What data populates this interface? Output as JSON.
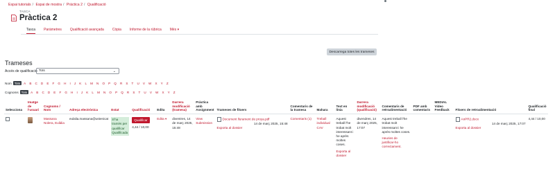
{
  "breadcrumbs": [
    "Espai tutorials",
    "Espai de mostra",
    "Pràctica 2",
    "Qualificació"
  ],
  "header": {
    "kicker": "TASCA",
    "title": "Pràctica 2"
  },
  "tabs": [
    {
      "label": "Tasca",
      "active": true
    },
    {
      "label": "Paràmetres",
      "active": false
    },
    {
      "label": "Qualificació avançada",
      "active": false
    },
    {
      "label": "Còpia",
      "active": false
    },
    {
      "label": "Informe de la rúbrica",
      "active": false
    },
    {
      "label": "Més ▾",
      "active": false
    }
  ],
  "download_button": "Descarrega totes les trameses",
  "section_title": "Trameses",
  "filter": {
    "label": "Accés de qualificació",
    "value": "Tots"
  },
  "alpha_filters": [
    {
      "label": "Nom",
      "all": "Tots"
    },
    {
      "label": "Cognoms",
      "all": "Tots"
    }
  ],
  "letters": [
    "A",
    "B",
    "C",
    "D",
    "E",
    "F",
    "G",
    "H",
    "I",
    "J",
    "K",
    "L",
    "M",
    "N",
    "O",
    "P",
    "Q",
    "R",
    "S",
    "T",
    "U",
    "V",
    "W",
    "X",
    "Y",
    "Z"
  ],
  "table": {
    "headers": [
      {
        "label": "Selecciona",
        "red": false
      },
      {
        "label": "Imatge de l'usuari",
        "red": true
      },
      {
        "label": "Cognoms / Nom",
        "red": true
      },
      {
        "label": "Adreça electrònica",
        "red": true
      },
      {
        "label": "Estat",
        "red": true
      },
      {
        "label": "Qualificació",
        "red": true
      },
      {
        "label": "Edita",
        "red": false
      },
      {
        "label": "Darrera modificació (tramesa)",
        "red": true
      },
      {
        "label": "Pràctica amb Assignment",
        "red": false
      },
      {
        "label": "Trameses de fitxers",
        "red": false
      },
      {
        "label": "Comentaris de la tramesa",
        "red": false
      },
      {
        "label": "Mahara",
        "red": false
      },
      {
        "label": "Text en línia",
        "red": false
      },
      {
        "label": "Darrera modificació (qualificació)",
        "red": true
      },
      {
        "label": "Comentaris de retroalimentació",
        "red": false
      },
      {
        "label": "PDF amb comentaris",
        "red": false
      },
      {
        "label": "MEDIAL Video Feedback",
        "red": false
      },
      {
        "label": "Fitxers de retroalimentació",
        "red": false
      },
      {
        "label": "Qualificació final",
        "red": false
      }
    ],
    "row": {
      "name": "Massana Nolera, Eulàlia",
      "email": "eulalia.massana@ustenicat",
      "status": "S'ha tramès per qualificar Qualificada",
      "grade_button": "Qualificar",
      "grade_value": "4,44 / 10,00",
      "edit": "Edita ▾",
      "last_mod_submission": "diventres, 14 de març 2025, 15:48",
      "assignment_link": "View Submission",
      "file_name": "Document llurament de proya.pdf",
      "file_date": "14 de març 2025, 15:48",
      "export_link": "Exporta al dossier",
      "comments": "Comentaris (1)",
      "mahara": "Treball individual CAV",
      "online_text": "Aquest treball l'he trobat molt interessant i he après moltes coses.",
      "export_link_2": "Exporta al dossier",
      "last_mod_grade": "divendres, 14 de març 2025, 17:07",
      "feedback_comment": "Aquest treball l'he trobat molt interessant i he après moltes coses.",
      "feedback_extra": "Heuries de justificar-ho correctament.",
      "feedback_file": "AnPR2.docx",
      "feedback_file_date": "14 de març 2025, 17:07",
      "export_link_3": "Exporta al dossier",
      "final_grade": "4,44 / 10,00"
    }
  }
}
